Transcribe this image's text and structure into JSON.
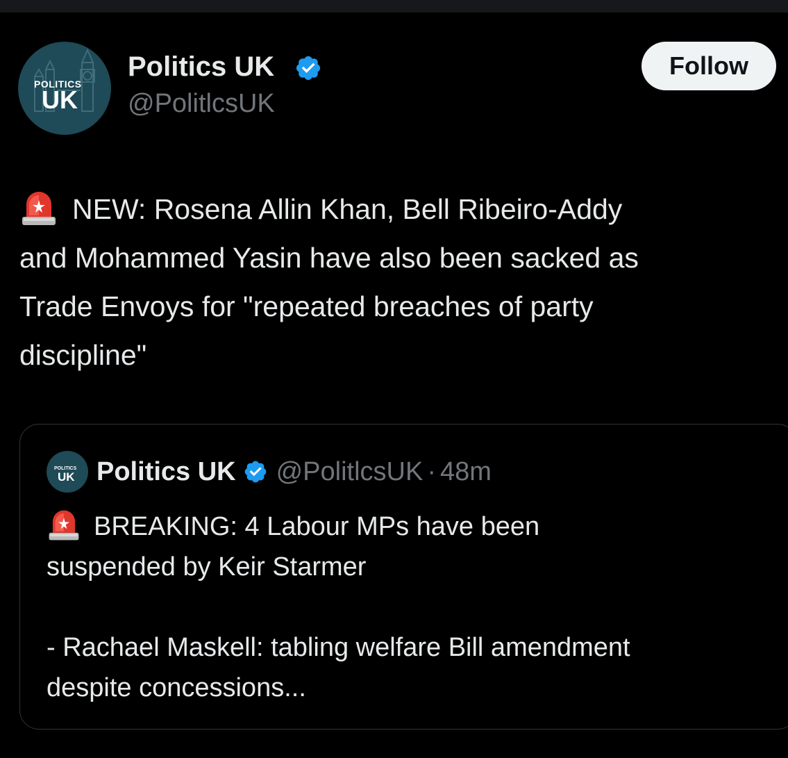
{
  "tweet": {
    "display_name": "Politics UK",
    "handle": "@PolitlcsUK",
    "verified_icon": "verified-badge-icon",
    "avatar": {
      "text_small": "POLITICS",
      "text_big": "UK",
      "bg_color": "#1f4a57"
    },
    "follow_label": "Follow",
    "siren_icon": "police-light-emoji",
    "text_lines": [
      "NEW: Rosena Allin Khan, Bell Ribeiro-Addy",
      "and Mohammed Yasin have also been sacked as",
      "Trade Envoys for \"repeated breaches of party",
      "discipline\""
    ]
  },
  "quoted_tweet": {
    "display_name": "Politics UK",
    "handle": "@PolitlcsUK",
    "separator": "·",
    "time": "48m",
    "avatar": {
      "text_small": "POLITICS",
      "text_big": "UK"
    },
    "text_lines": [
      "BREAKING: 4 Labour MPs have been",
      "suspended by Keir Starmer",
      "",
      "- Rachael Maskell: tabling welfare Bill amendment",
      "despite concessions..."
    ]
  },
  "colors": {
    "background": "#000000",
    "text_primary": "#e7e9ea",
    "text_secondary": "#71767b",
    "verified_blue": "#1d9bf0",
    "follow_bg": "#eff3f4",
    "border": "#2f3336"
  }
}
